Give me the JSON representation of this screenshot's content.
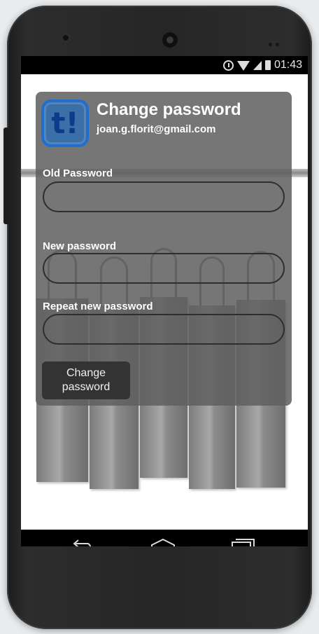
{
  "status_bar": {
    "time": "01:43",
    "icons": [
      "alarm-icon",
      "wifi-icon",
      "signal-icon",
      "battery-icon"
    ]
  },
  "app": {
    "logo_text": "t!",
    "logo_color": "#1f6fd1"
  },
  "dialog": {
    "title": "Change password",
    "email": "joan.g.florit@gmail.com",
    "old_password_label": "Old Password",
    "old_password_value": "",
    "new_password_label": "New password",
    "new_password_value": "",
    "repeat_password_label": "Repeat new password",
    "repeat_password_value": "",
    "submit_label": "Change password"
  },
  "nav_bar": {
    "icons": [
      "back-icon",
      "home-icon",
      "recent-apps-icon"
    ]
  }
}
